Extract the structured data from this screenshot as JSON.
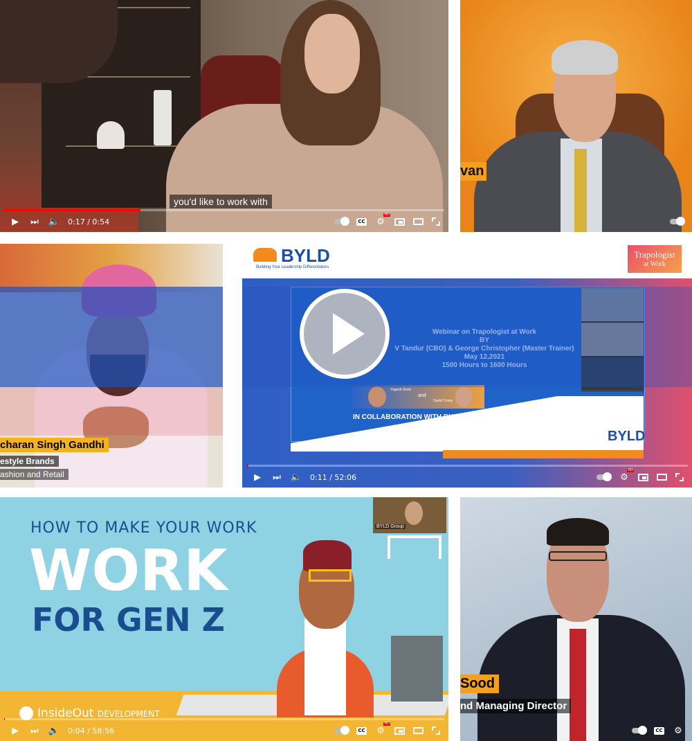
{
  "colors": {
    "progress_red": "#ff0000",
    "blue_band": "#2f5fc4",
    "byld_blue": "#1d4fa0",
    "accent_orange": "#f28a1e"
  },
  "tile1": {
    "caption": "you'd like to work with",
    "time": "0:17 / 0:54",
    "progress": 0.31
  },
  "tile2": {
    "name_tag": "van"
  },
  "tile3": {
    "name": "charan Singh Gandhi",
    "line1": "estyle Brands",
    "line2": "ashion and Retail"
  },
  "tile4": {
    "logo": "BYLD",
    "tagline": "Building Your Leadership Differentiators",
    "badge_line1": "Trapologist",
    "badge_line2": "at Work",
    "webinar": [
      "Webinar on Trapologist at Work",
      "BY",
      "V Tandur (CBO) & George Christopher (Master Trainer)",
      "May 12,2021",
      "1500 Hours to 1600 Hours"
    ],
    "speaker1": "Yogesh Sood",
    "and": "and",
    "speaker2": "David Covey",
    "collab": "IN COLLABORATION WITH BYLD GROUP",
    "logo_bottom": "BYLD",
    "time": "0:11 / 52:06",
    "progress": 0.004
  },
  "tile5": {
    "headline_small": "HOW TO MAKE YOUR WORK",
    "headline_big1": "WORK",
    "headline_big2": "FOR GEN Z",
    "brand": "InsideOut",
    "brand2": "DEVELOPMENT",
    "pip_label": "BYLD Group",
    "time": "0:04 / 58:56",
    "progress": 0.001
  },
  "tile6": {
    "name_tag": "Sood",
    "title": "nd Managing Director"
  }
}
